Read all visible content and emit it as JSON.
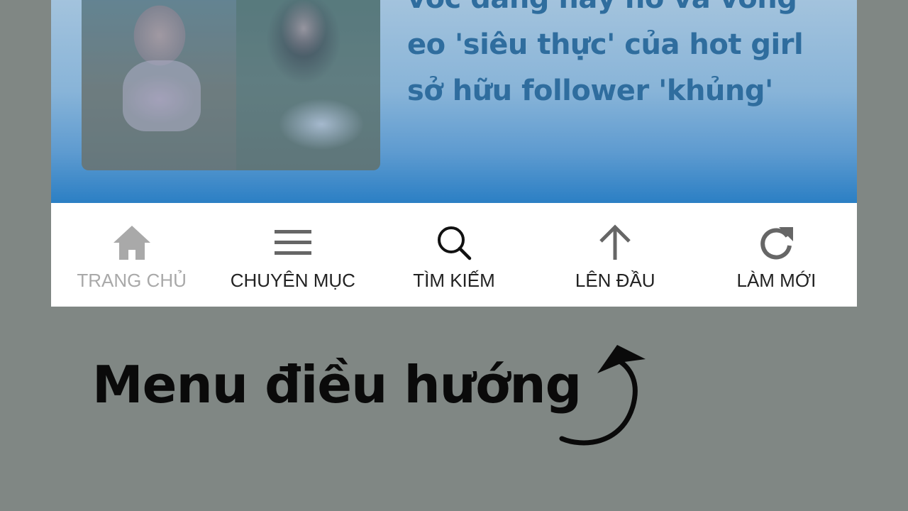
{
  "article": {
    "headline_line1": "vóc dáng nảy nở và vòng",
    "headline_line2": "eo 'siêu thực' của hot girl",
    "headline_line3": "sở hữu follower 'khủng'"
  },
  "nav": {
    "items": [
      {
        "label": "TRANG CHỦ",
        "icon": "home-icon",
        "active": true
      },
      {
        "label": "CHUYÊN MỤC",
        "icon": "menu-icon",
        "active": false
      },
      {
        "label": "TÌM KIẾM",
        "icon": "search-icon",
        "active": false
      },
      {
        "label": "LÊN ĐẦU",
        "icon": "arrow-up-icon",
        "active": false
      },
      {
        "label": "LÀM MỚI",
        "icon": "refresh-icon",
        "active": false
      }
    ]
  },
  "annotation": {
    "caption": "Menu điều hướng"
  },
  "colors": {
    "background": "#808784",
    "card_gradient_top": "#a3c3dd",
    "card_gradient_bottom": "#2b7fc4",
    "headline": "#2f6d9e",
    "nav_bg": "#ffffff",
    "nav_label": "#222222",
    "nav_active": "#a9a9a9",
    "nav_icon": "#666666"
  }
}
